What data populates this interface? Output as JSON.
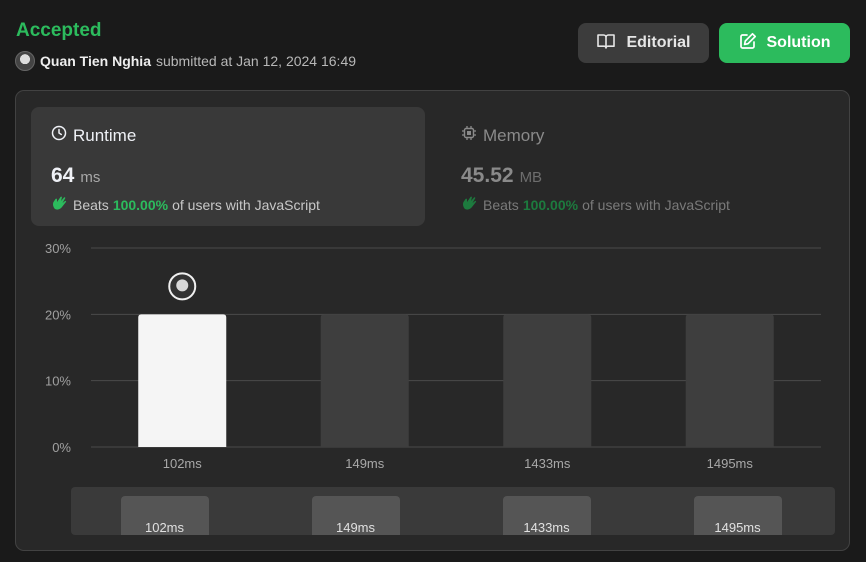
{
  "header": {
    "status": "Accepted",
    "user": "Quan Tien Nghia",
    "submitted_text": "submitted at Jan 12, 2024 16:49"
  },
  "buttons": {
    "editorial": "Editorial",
    "solution": "Solution"
  },
  "runtime": {
    "title": "Runtime",
    "value": "64",
    "unit": "ms",
    "beats_label": "Beats",
    "beats_pct": "100.00%",
    "beats_suffix": "of users with JavaScript"
  },
  "memory": {
    "title": "Memory",
    "value": "45.52",
    "unit": "MB",
    "beats_label": "Beats",
    "beats_pct": "100.00%",
    "beats_suffix": "of users with JavaScript"
  },
  "chart_data": {
    "type": "bar",
    "categories": [
      "102ms",
      "149ms",
      "1433ms",
      "1495ms"
    ],
    "values": [
      20,
      20,
      20,
      20
    ],
    "highlight_index": 0,
    "ylim": [
      0,
      30
    ],
    "yticks": [
      "0%",
      "10%",
      "20%",
      "30%"
    ],
    "colors": {
      "highlight": "#f5f5f5",
      "bar": "#3e3e3e",
      "grid": "#4a4a4a"
    }
  },
  "range_selector": {
    "labels": [
      "102ms",
      "149ms",
      "1433ms",
      "1495ms"
    ]
  }
}
